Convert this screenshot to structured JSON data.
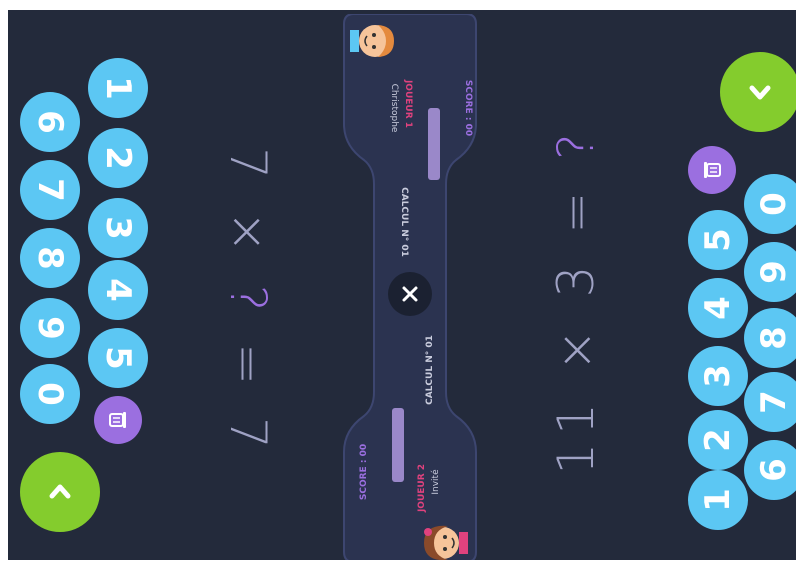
{
  "player1": {
    "title": "JOUEUR 1",
    "name": "Christophe",
    "score_label": "SCORE : 00",
    "calc_label": "CALCUL N° 01",
    "equation": {
      "left": "7 × ",
      "unknown": "?",
      "right": " = 7"
    },
    "keys": [
      "1",
      "2",
      "3",
      "4",
      "5",
      "6",
      "7",
      "8",
      "9",
      "0"
    ]
  },
  "player2": {
    "title": "JOUEUR 2",
    "name": "Invité",
    "score_label": "SCORE : 00",
    "calc_label": "CALCUL N° 01",
    "equation": {
      "left": "11 × 3 = ",
      "unknown": "?",
      "right": ""
    },
    "keys": [
      "1",
      "2",
      "3",
      "4",
      "5",
      "6",
      "7",
      "8",
      "9",
      "0"
    ]
  },
  "colors": {
    "background": "#232a3b",
    "key": "#5cc7f3",
    "trash": "#9b6fe0",
    "validate": "#84cc2d",
    "player_label": "#e0427e",
    "score": "#9b6fe0"
  },
  "icons": {
    "trash": "trash-icon",
    "validate": "chevron-icon",
    "close": "close-icon"
  }
}
